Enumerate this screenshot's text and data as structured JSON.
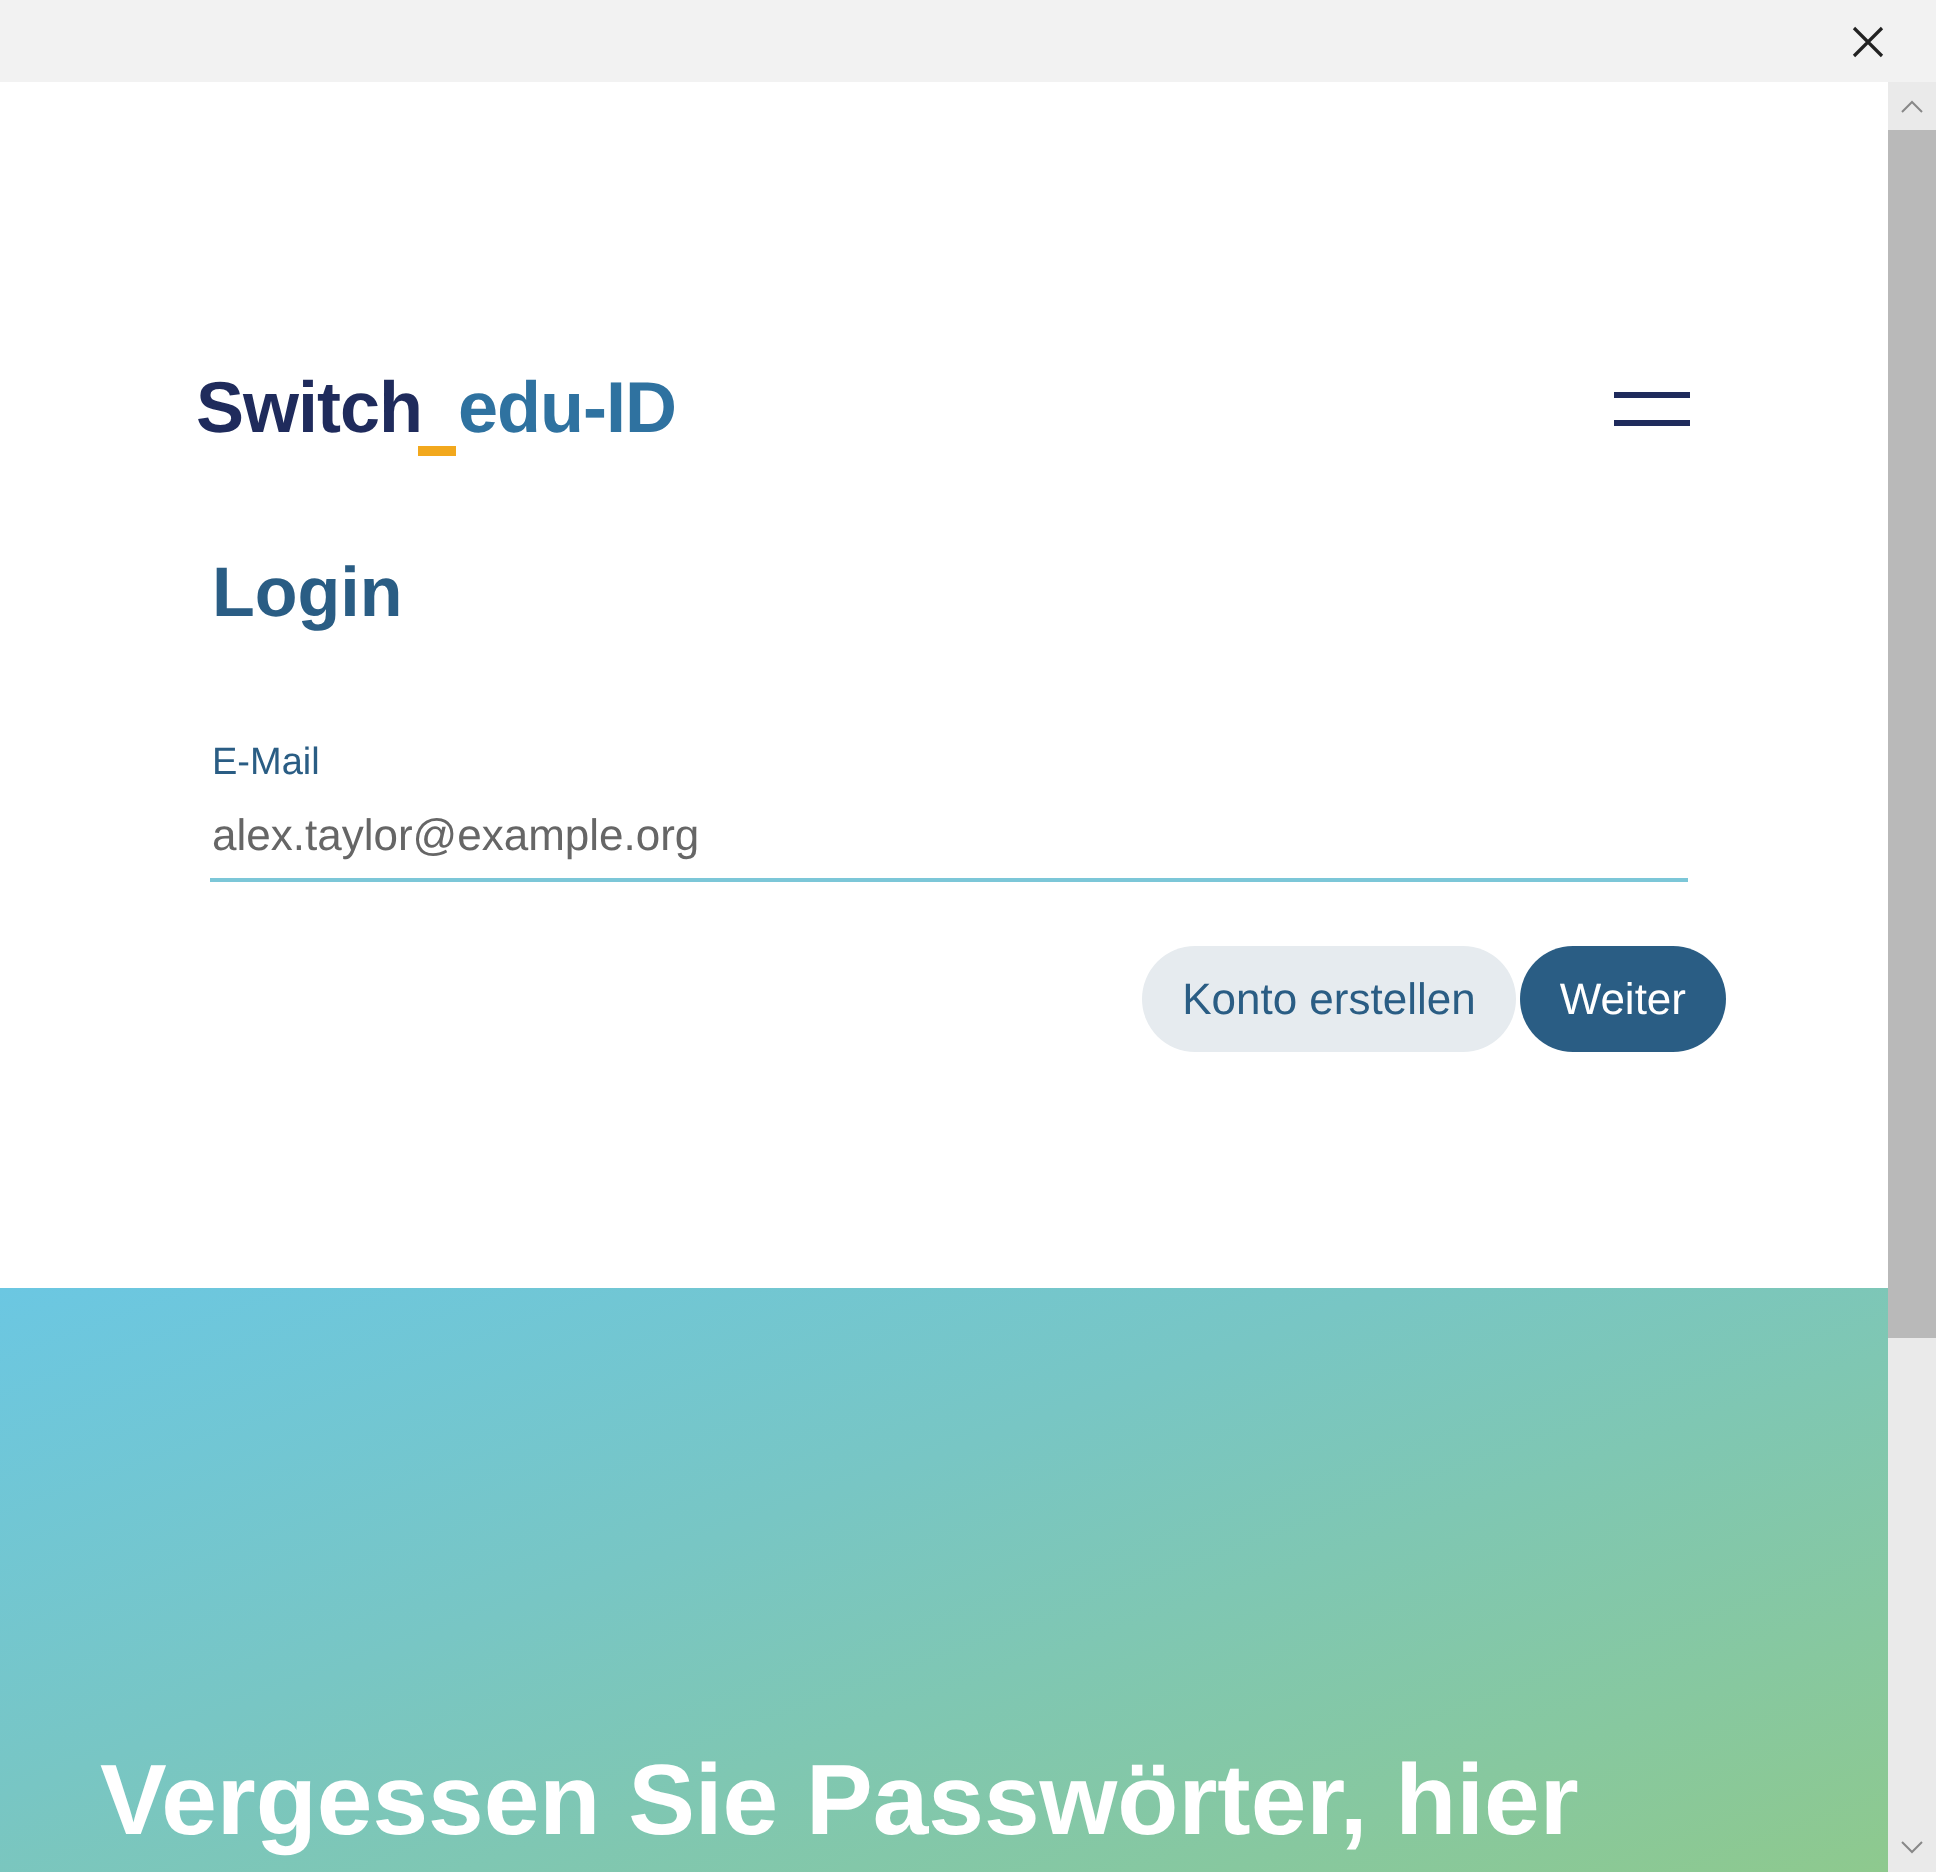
{
  "logo": {
    "primary": "Switch",
    "secondary": "edu-ID"
  },
  "login": {
    "title": "Login",
    "email_label": "E-Mail",
    "email_value": "alex.taylor@example.org"
  },
  "buttons": [
    {
      "label": "Konto erstellen",
      "kind": "secondary"
    },
    {
      "label": "Weiter",
      "kind": "primary"
    }
  ],
  "hero": {
    "headline": "Vergessen Sie Passwörter, hier"
  }
}
